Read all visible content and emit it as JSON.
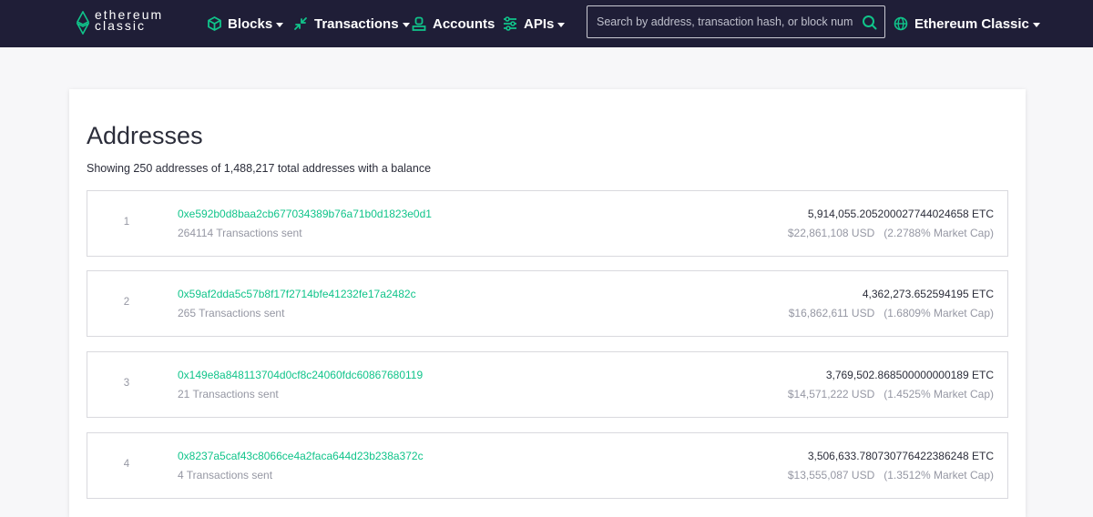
{
  "brand": {
    "line1": "ethereum",
    "line2": "classic"
  },
  "nav": {
    "blocks": "Blocks",
    "transactions": "Transactions",
    "accounts": "Accounts",
    "apis": "APIs",
    "network": "Ethereum Classic"
  },
  "search": {
    "placeholder": "Search by address, transaction hash, or block number"
  },
  "colors": {
    "header": "#1f1e37",
    "accent": "#10c48a"
  },
  "page": {
    "title": "Addresses",
    "summary": "Showing 250 addresses of 1,488,217 total addresses with a balance"
  },
  "addresses": [
    {
      "rank": "1",
      "address": "0xe592b0d8baa2cb677034389b76a71b0d1823e0d1",
      "tx_sent": "264114 Transactions sent",
      "balance": "5,914,055.205200027744024658 ETC",
      "usd": "$22,861,108 USD",
      "market_cap": "(2.2788% Market Cap)"
    },
    {
      "rank": "2",
      "address": "0x59af2dda5c57b8f17f2714bfe41232fe17a2482c",
      "tx_sent": "265 Transactions sent",
      "balance": "4,362,273.652594195 ETC",
      "usd": "$16,862,611 USD",
      "market_cap": "(1.6809% Market Cap)"
    },
    {
      "rank": "3",
      "address": "0x149e8a848113704d0cf8c24060fdc60867680119",
      "tx_sent": "21 Transactions sent",
      "balance": "3,769,502.868500000000189 ETC",
      "usd": "$14,571,222 USD",
      "market_cap": "(1.4525% Market Cap)"
    },
    {
      "rank": "4",
      "address": "0x8237a5caf43c8066ce4a2faca644d23b238a372c",
      "tx_sent": "4 Transactions sent",
      "balance": "3,506,633.780730776422386248 ETC",
      "usd": "$13,555,087 USD",
      "market_cap": "(1.3512% Market Cap)"
    }
  ]
}
